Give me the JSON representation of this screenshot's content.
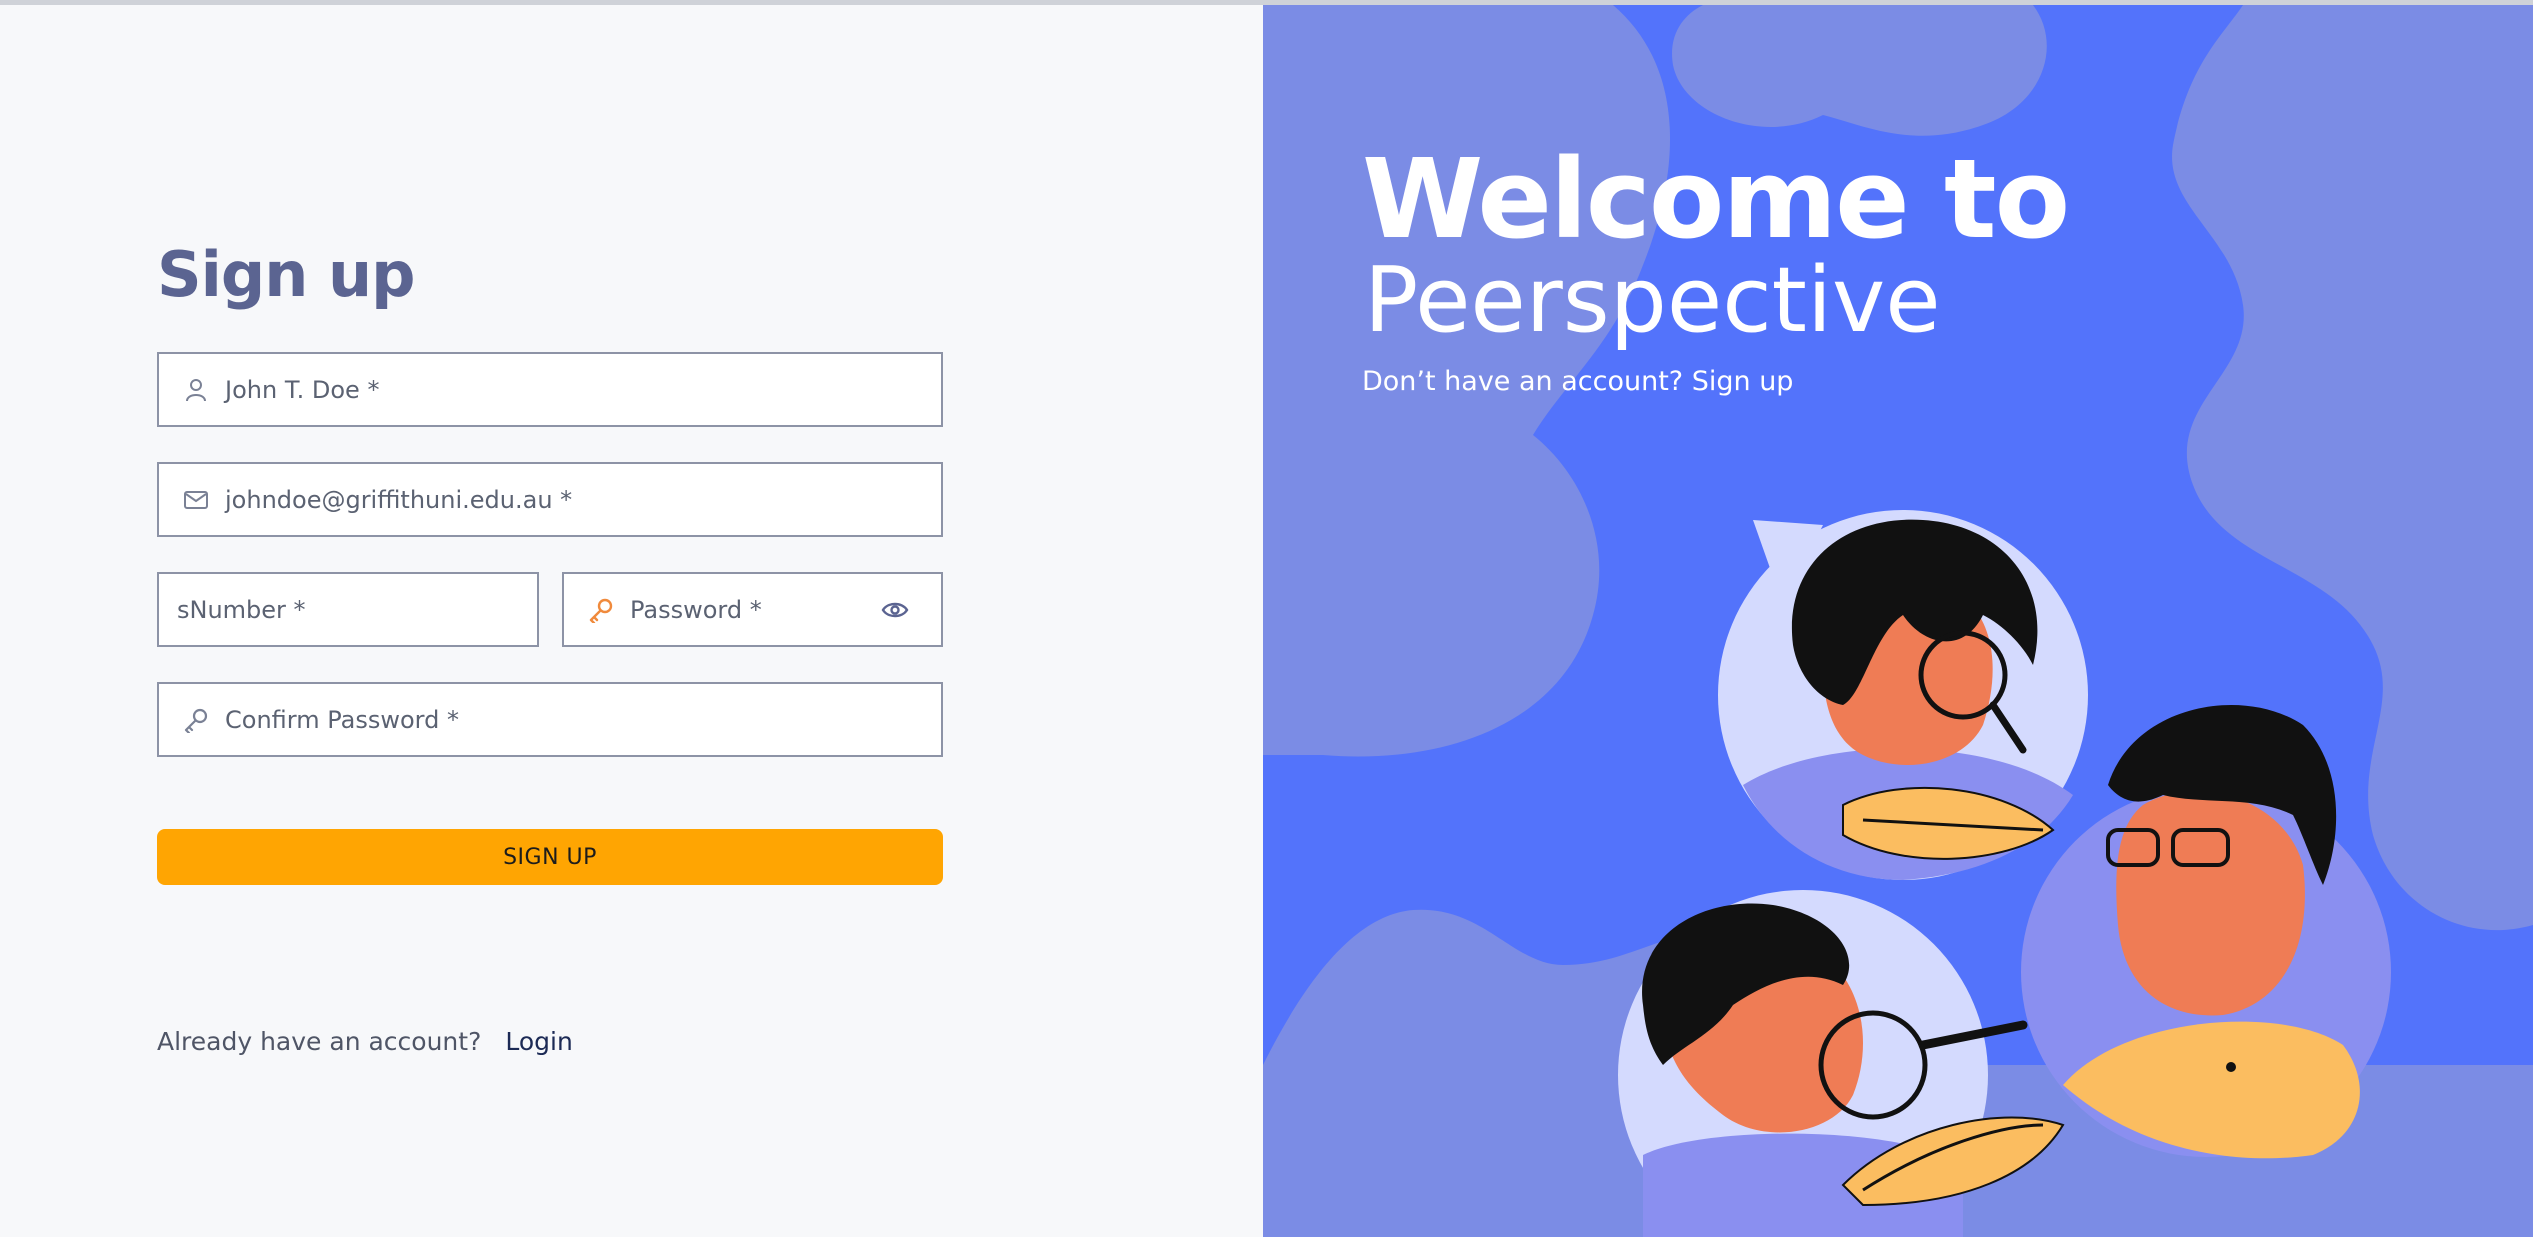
{
  "form": {
    "title": "Sign up",
    "name_placeholder": "John T. Doe *",
    "email_placeholder": "johndoe@griffithuni.edu.au *",
    "snumber_placeholder": "sNumber *",
    "password_placeholder": "Password *",
    "confirm_password_placeholder": "Confirm Password *",
    "submit_label": "SIGN UP",
    "footer_text": "Already have an account?",
    "login_link": "Login"
  },
  "hero": {
    "heading_line1": "Welcome to",
    "heading_line2": "Peerspective",
    "subtext": "Don’t have an account? Sign up"
  },
  "icons": {
    "name": "user-icon",
    "email": "mail-icon",
    "password": "key-icon",
    "toggle": "eye-icon",
    "confirm": "key-icon"
  },
  "colors": {
    "accent_button": "#ffa502",
    "hero_background": "#5373fb",
    "title_color": "#5b6491",
    "key_icon_active": "#f08a3c"
  }
}
